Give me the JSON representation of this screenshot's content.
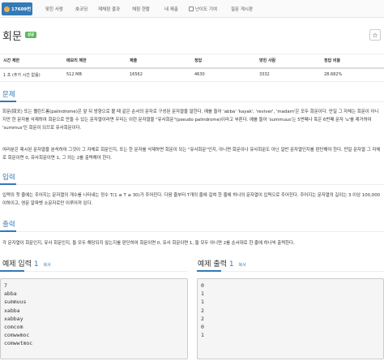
{
  "nav": {
    "problem_tab": "17609번",
    "items": [
      "맞힌 사람",
      "숏코딩",
      "재채점 결과",
      "채점 현황",
      "내 제출",
      "난이도 기여",
      "질문 게시판"
    ]
  },
  "problem": {
    "title": "회문",
    "badge": "성공"
  },
  "info": {
    "headers": [
      "시간 제한",
      "메모리 제한",
      "제출",
      "정답",
      "맞힌 사람",
      "정답 비율"
    ],
    "values": [
      "1 초 (추가 시간 없음)",
      "512 MB",
      "16562",
      "4630",
      "3332",
      "28.682%"
    ]
  },
  "sections": {
    "description_title": "문제",
    "description_p1": "회문(回文) 또는 팰린드롬(palindrome)은 앞 뒤 방향으로 볼 때 같은 순서의 문자로 구성된 문자열을 말한다. 예를 들어 'abba' 'kayak', 'reviver', 'madam'은 모두 회문이다. 만일 그 자체는 회문이 아니지만 한 문자를 삭제하여 회문으로 만들 수 있는 문자열이라면 우리는 이런 문자열을 \"유사회문\"(pseudo palindrome)이라고 부른다. 예를 들어 'summuus'는 5번째나 혹은 6번째 문자 'u'를 제거하여 'summus'인 회문이 되므로 유사회문이다.",
    "description_p2": "여러분은 제시된 문자열을 분석하여 그것이 그 자체로 회문인지, 또는 한 문자를 삭제하면 회문이 되는 \"유사회문\"인지, 아니면 회문이나 유사회문도 아닌 일반 문자열인지를 판단해야 한다. 만일 문자열 그 자체로 회문이면 0, 유사회문이면 1, 그 외는 2를 출력해야 한다.",
    "input_title": "입력",
    "input_p": "입력의 첫 줄에는 주어지는 문자열의 개수를 나타내는 정수 T(1 ≤ T ≤ 30)가 주어진다. 다음 줄부터 T개의 줄에 걸쳐 한 줄에 하나의 문자열이 입력으로 주어진다. 주어지는 문자열의 길이는 3 이상 100,000 이하이고, 영문 알파벳 소문자로만 이루어져 있다.",
    "output_title": "출력",
    "output_p": "각 문자열이 회문인지, 유사 회문인지, 둘 모두 해당되지 않는지를 판단하여 회문이면 0, 유사 회문이면 1, 둘 모두 아니면 2를 순서대로 한 줄에 하나씩 출력한다."
  },
  "samples": {
    "input_label": "예제 입력",
    "output_label": "예제 출력",
    "number": "1",
    "copy": "복사",
    "input_text": "7\nabba\nsummuus\nxabba\nxabbay\ncomcom\ncomwwmoc\ncomwwtmoc",
    "output_text": "0\n1\n1\n2\n2\n0\n1"
  }
}
